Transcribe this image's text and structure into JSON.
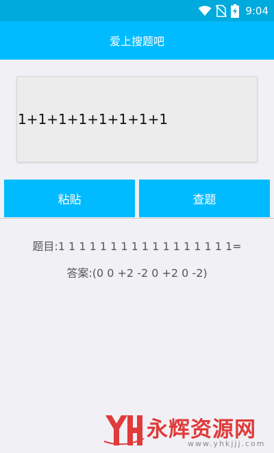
{
  "status_bar": {
    "time": "9:04",
    "icons": [
      "wifi-icon",
      "no-sim-icon",
      "battery-charging-icon"
    ]
  },
  "app_bar": {
    "title": "爱上搜题吧"
  },
  "input": {
    "value": "1+1+1+1+1+1+1+1"
  },
  "buttons": {
    "paste_label": "粘贴",
    "search_label": "查题"
  },
  "result": {
    "question_label": "题目:",
    "question_value": "1 1 1 1 1 1 1 1 1 1 1 1 1 1 1 1 1=",
    "answer_label": "答案:",
    "answer_value": "(0 0 +2 -2 0 +2 0 -2)"
  },
  "watermark": {
    "logo_text": "YH",
    "title": "永辉资源网",
    "url": "www.yhkjjj.com"
  },
  "colors": {
    "status_bar": "#00aadd",
    "app_bar": "#00bbff",
    "button": "#00bbff",
    "background": "#f1f0f5",
    "watermark_red": "#e03a3a"
  }
}
